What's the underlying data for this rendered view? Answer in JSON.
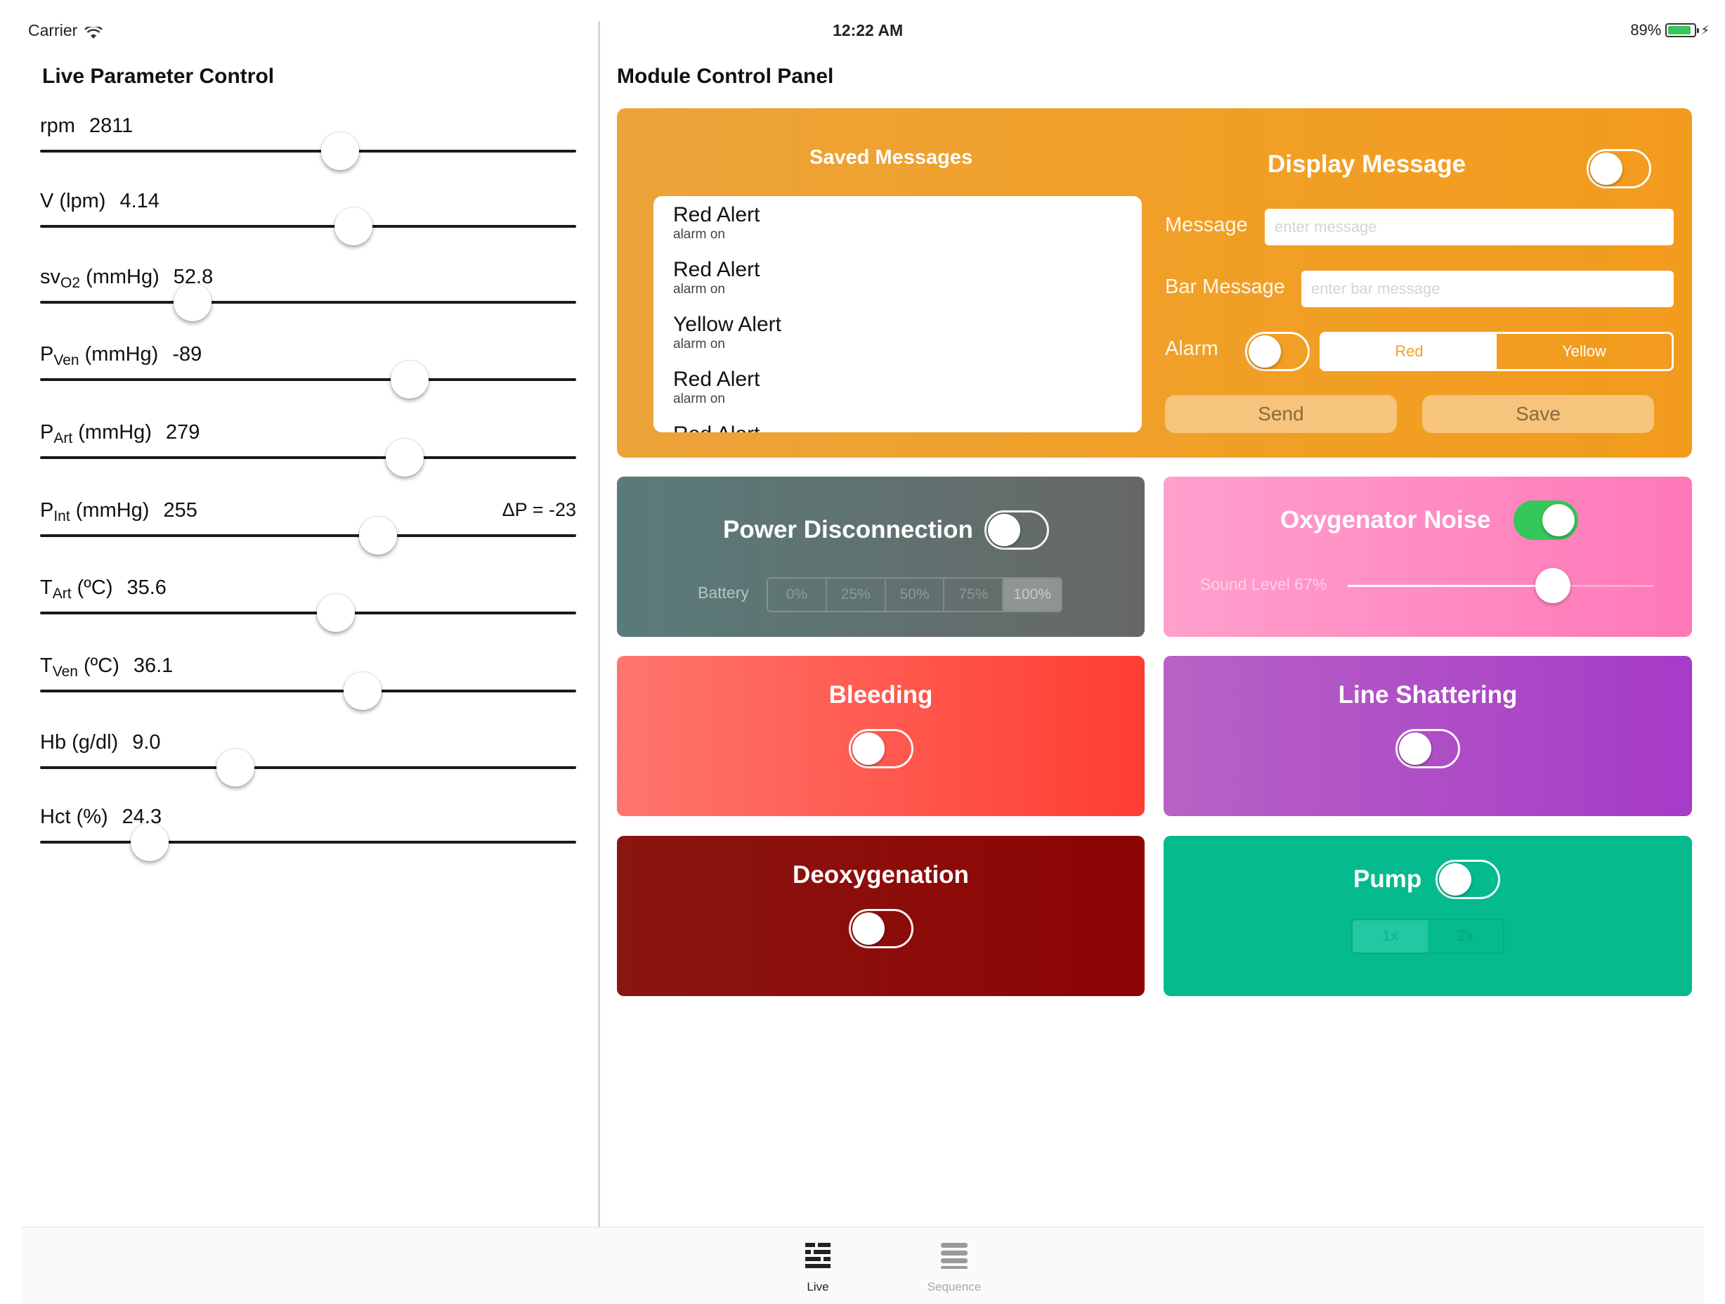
{
  "status_bar": {
    "carrier": "Carrier",
    "time": "12:22 AM",
    "battery_percent": "89%",
    "battery_level": 0.89,
    "icons": [
      "wifi-icon",
      "battery-icon",
      "charging-bolt-icon"
    ]
  },
  "left_panel": {
    "title": "Live Parameter Control",
    "parameters": [
      {
        "name": "rpm",
        "sub": "",
        "unit": "",
        "value": "2811",
        "slider_fraction": 0.56
      },
      {
        "name": "V",
        "sub": "",
        "unit": "(lpm)",
        "value": "4.14",
        "slider_fraction": 0.585
      },
      {
        "name": "sv",
        "sub": "O2",
        "unit": "(mmHg)",
        "value": "52.8",
        "slider_fraction": 0.285
      },
      {
        "name": "P",
        "sub": "Ven",
        "unit": "(mmHg)",
        "value": "-89",
        "slider_fraction": 0.69
      },
      {
        "name": "P",
        "sub": "Art",
        "unit": "(mmHg)",
        "value": "279",
        "slider_fraction": 0.68
      },
      {
        "name": "P",
        "sub": "Int",
        "unit": "(mmHg)",
        "value": "255",
        "slider_fraction": 0.63,
        "extra": "ΔP = -23"
      },
      {
        "name": "T",
        "sub": "Art",
        "unit": "(ºC)",
        "value": "35.6",
        "slider_fraction": 0.552
      },
      {
        "name": "T",
        "sub": "Ven",
        "unit": "(ºC)",
        "value": "36.1",
        "slider_fraction": 0.602
      },
      {
        "name": "Hb",
        "sub": "",
        "unit": "(g/dl)",
        "value": "9.0",
        "slider_fraction": 0.365
      },
      {
        "name": "Hct",
        "sub": "",
        "unit": "(%)",
        "value": "24.3",
        "slider_fraction": 0.205
      }
    ]
  },
  "right_panel": {
    "title": "Module Control Panel",
    "message_card": {
      "saved_title": "Saved Messages",
      "saved_messages": [
        {
          "title": "Red Alert",
          "subtitle": "alarm on"
        },
        {
          "title": "Red Alert",
          "subtitle": "alarm on"
        },
        {
          "title": "Yellow Alert",
          "subtitle": "alarm on"
        },
        {
          "title": "Red Alert",
          "subtitle": "alarm on"
        },
        {
          "title": "Red Alert",
          "subtitle": ""
        }
      ],
      "display_title": "Display Message",
      "display_toggle_on": false,
      "message_label": "Message",
      "message_placeholder": "enter message",
      "bar_message_label": "Bar Message",
      "bar_message_placeholder": "enter bar message",
      "alarm_label": "Alarm",
      "alarm_toggle_on": false,
      "alarm_options": [
        "Red",
        "Yellow"
      ],
      "alarm_selected": "Red",
      "send_label": "Send",
      "save_label": "Save"
    },
    "power_card": {
      "title": "Power Disconnection",
      "toggle_on": false,
      "battery_label": "Battery",
      "battery_options": [
        "0%",
        "25%",
        "50%",
        "75%",
        "100%"
      ],
      "battery_selected": "100%",
      "color": "#5d7473"
    },
    "oxygenator_card": {
      "title": "Oxygenator Noise",
      "toggle_on": true,
      "sound_label": "Sound Level 67%",
      "sound_level": 0.67,
      "color": "#ff8cc3"
    },
    "bleeding_card": {
      "title": "Bleeding",
      "toggle_on": false,
      "color": "#ff5a50"
    },
    "line_card": {
      "title": "Line Shattering",
      "toggle_on": false,
      "color": "#b04ec6"
    },
    "deoxygenation_card": {
      "title": "Deoxygenation",
      "toggle_on": false,
      "color": "#8b0d0a"
    },
    "pump_card": {
      "title": "Pump",
      "toggle_on": false,
      "speed_options": [
        "1x",
        "2x"
      ],
      "speed_selected": "1x",
      "color": "#05bb8d"
    }
  },
  "tab_bar": {
    "tabs": [
      {
        "label": "Live",
        "icon": "live-icon",
        "selected": true
      },
      {
        "label": "Sequence",
        "icon": "sequence-icon",
        "selected": false
      }
    ]
  }
}
